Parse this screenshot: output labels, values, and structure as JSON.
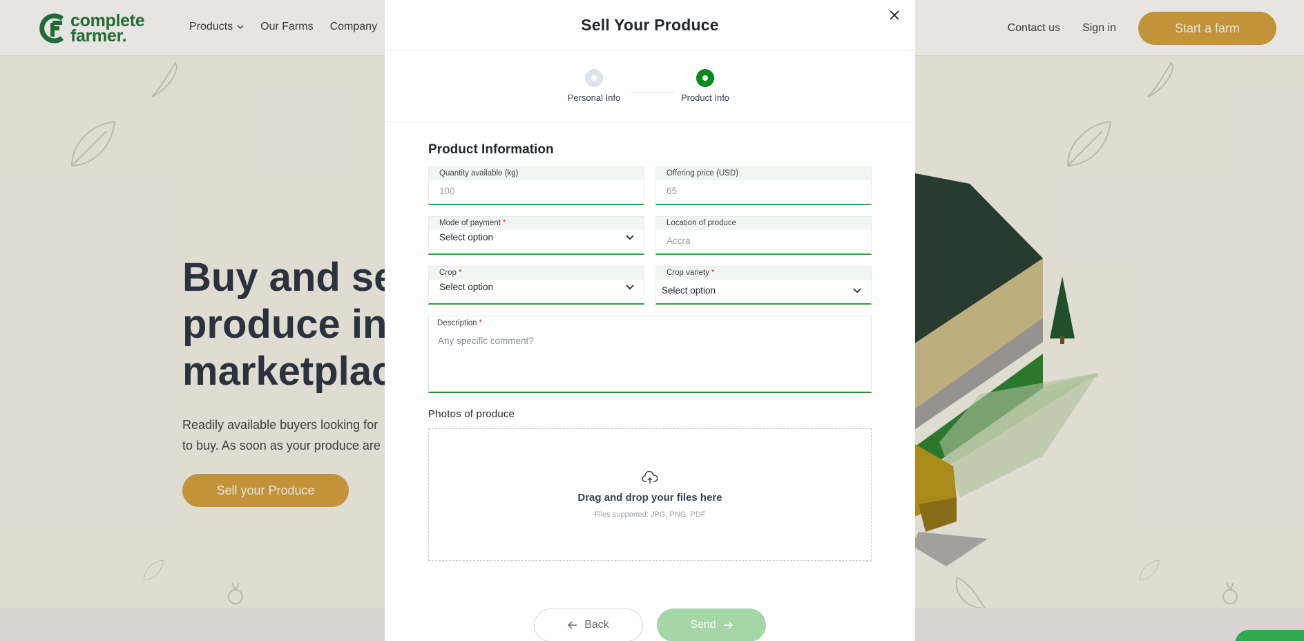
{
  "brand": {
    "line1": "complete",
    "line2": "farmer."
  },
  "nav": {
    "links": [
      "Products",
      "Our Farms",
      "Company"
    ],
    "right_links": [
      "Contact us",
      "Sign in"
    ],
    "cta": "Start a farm"
  },
  "hero": {
    "title_lines": [
      "Buy and sel",
      "produce in",
      "marketplac"
    ],
    "subtitle_lines": [
      "Readily available buyers looking for",
      "to buy. As soon as your produce are"
    ],
    "cta": "Sell your Produce"
  },
  "modal": {
    "title": "Sell Your Produce",
    "steps": [
      {
        "label": "Personal Info",
        "active": false
      },
      {
        "label": "Product Info",
        "active": true
      }
    ],
    "section_title": "Product Information",
    "fields": {
      "quantity": {
        "label": "Quantity available (kg)",
        "placeholder": "100"
      },
      "price": {
        "label": "Offering price (USD)",
        "placeholder": "65"
      },
      "payment": {
        "label": "Mode of payment",
        "value": "Select option",
        "required": true
      },
      "location": {
        "label": "Location of produce",
        "placeholder": "Accra"
      },
      "crop": {
        "label": "Crop",
        "value": "Select option",
        "required": true
      },
      "variety": {
        "label": "Crop variety",
        "value": "Select option",
        "required": true
      },
      "description": {
        "label": "Description",
        "placeholder": "Any specific comment?",
        "required": true
      }
    },
    "photos": {
      "title": "Photos of produce",
      "drop_text": "Drag and drop your files here",
      "supported": "Files supported: JPG, PNG, PDF"
    },
    "buttons": {
      "back": "Back",
      "send": "Send"
    }
  },
  "colors": {
    "brand_green": "#0e6b2f",
    "active_step": "#008a1d",
    "gold": "#d39b33",
    "send_disabled": "#a5d6a7"
  },
  "icons": [
    "logo-mark",
    "chevron-down-icon",
    "close-icon",
    "upload-cloud-icon",
    "arrow-left-icon",
    "arrow-right-icon"
  ]
}
